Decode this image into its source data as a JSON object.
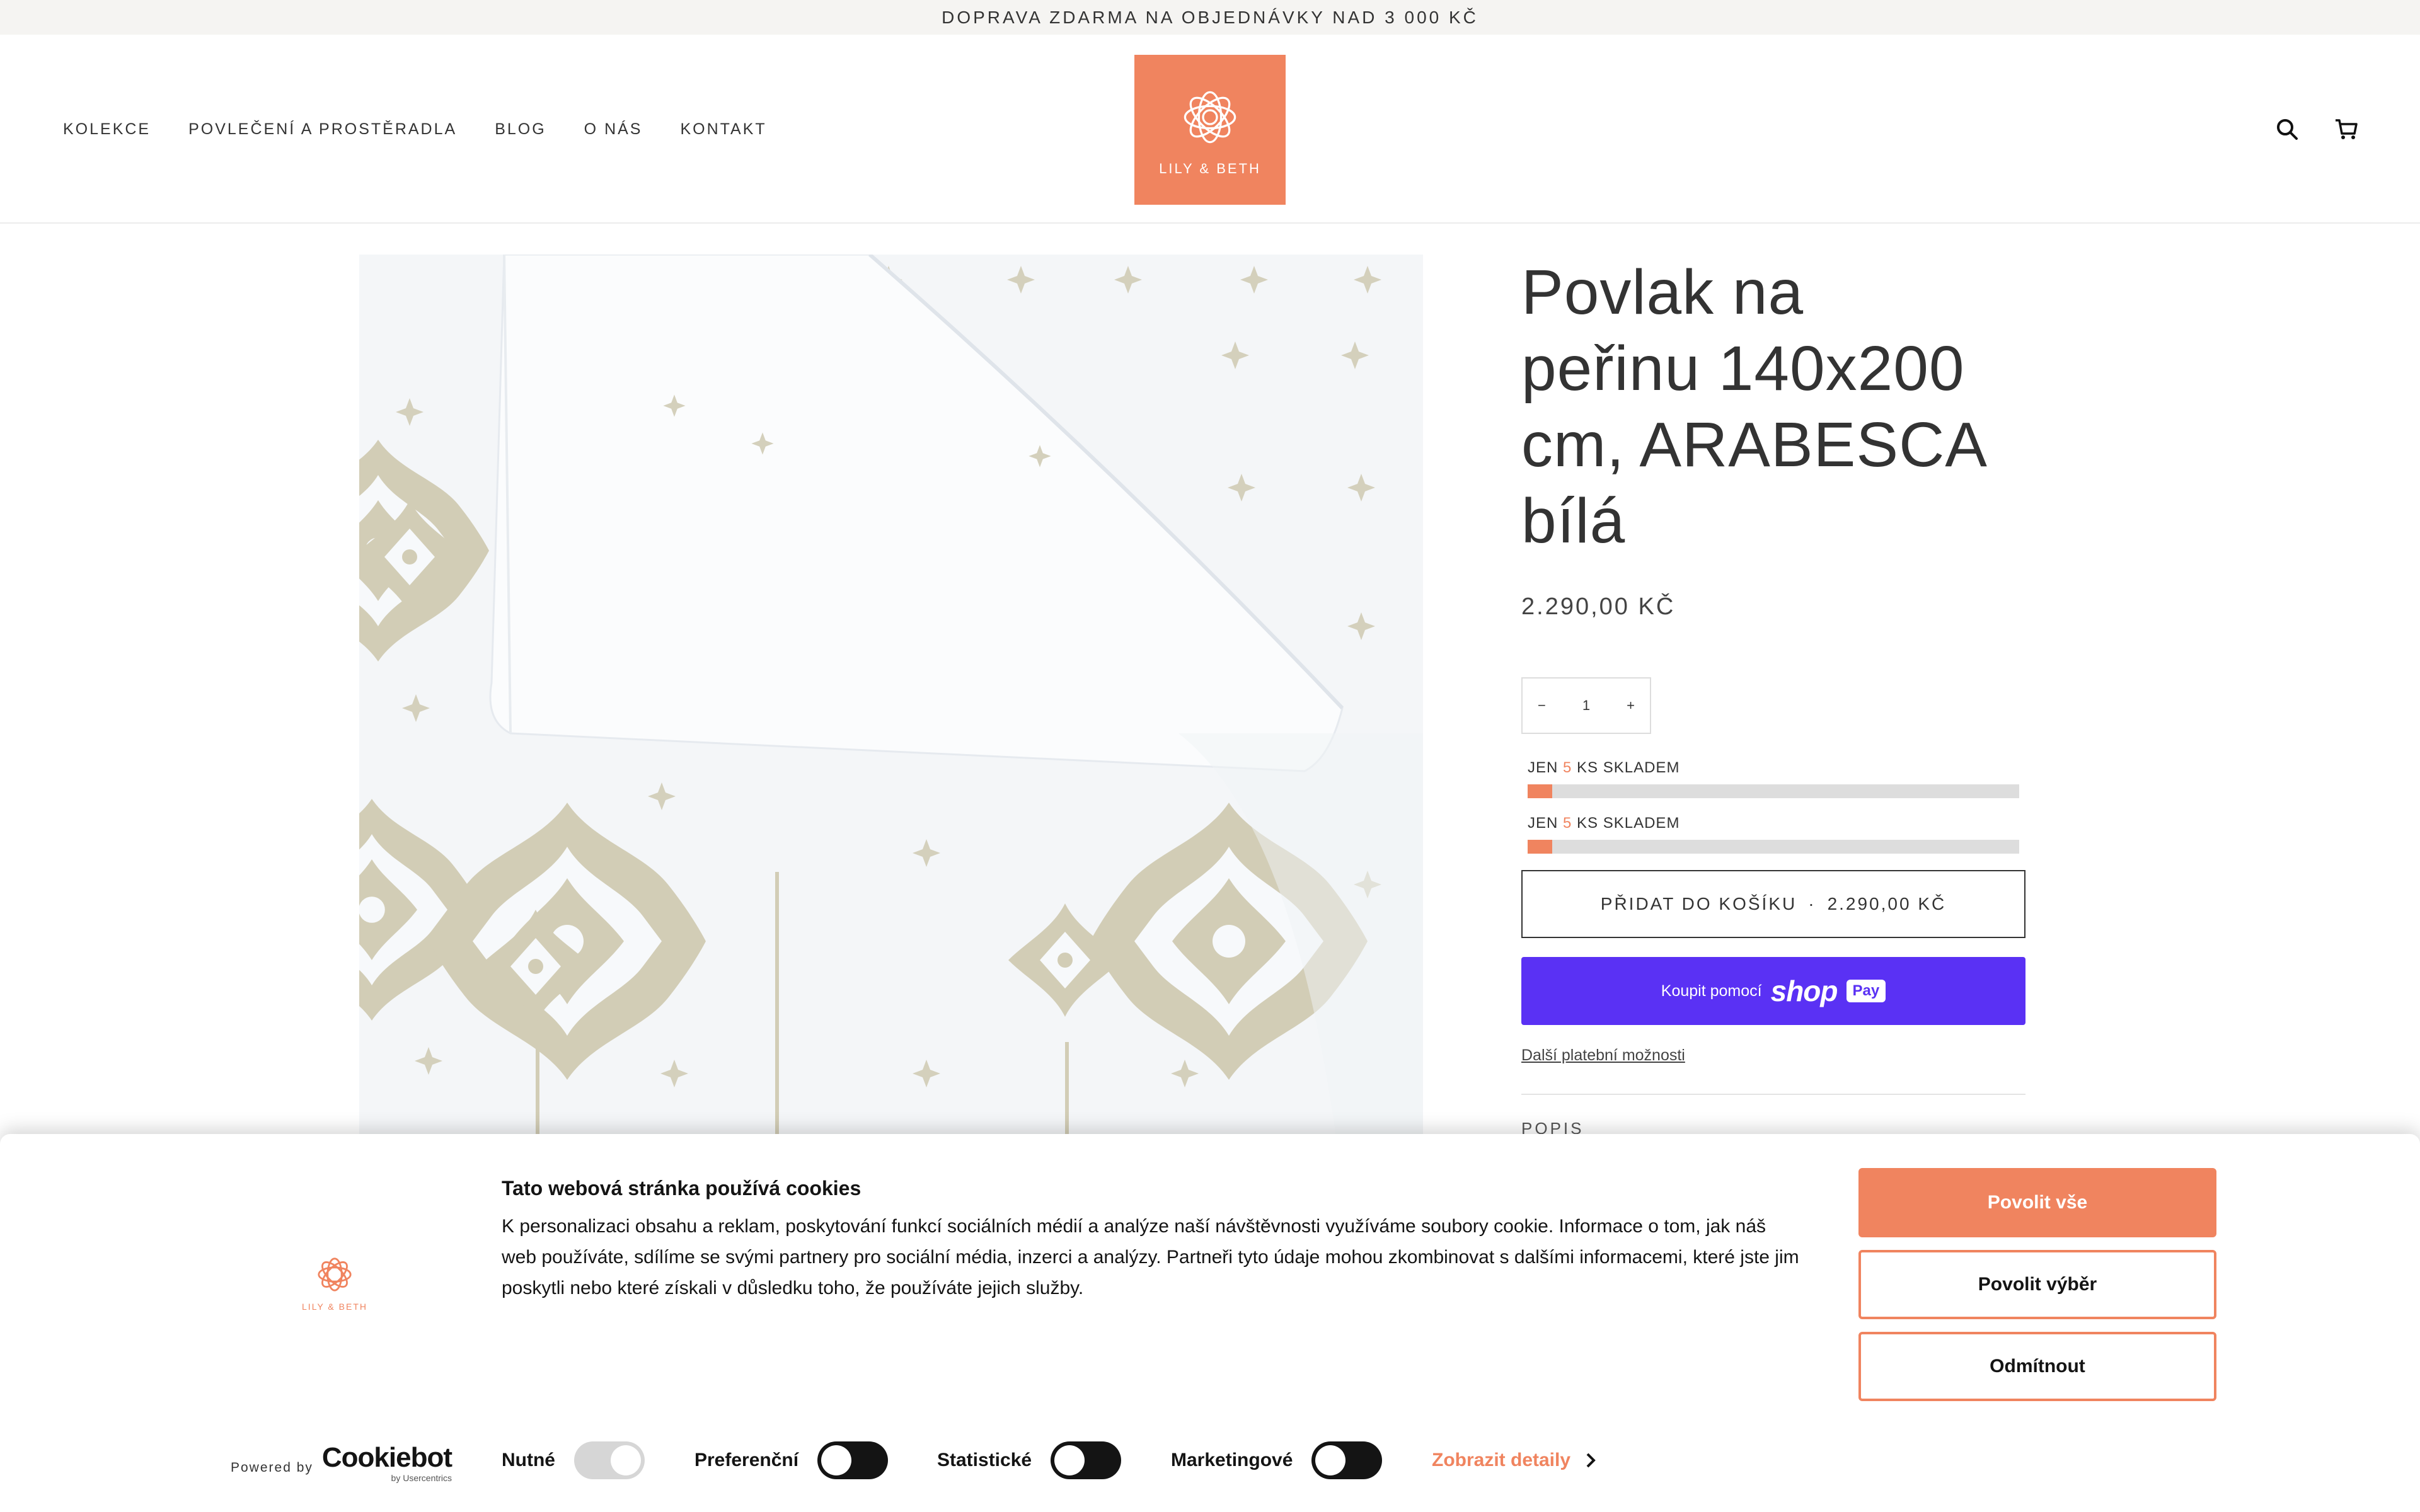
{
  "announcement": "DOPRAVA ZDARMA NA OBJEDNÁVKY NAD 3 000 KČ",
  "nav": {
    "items": [
      "KOLEKCE",
      "POVLEČENÍ A PROSTĚRADLA",
      "BLOG",
      "O NÁS",
      "KONTAKT"
    ]
  },
  "logo": {
    "text": "LILY & BETH"
  },
  "header_icons": [
    "search-icon",
    "cart-icon"
  ],
  "product": {
    "title": "Povlak na peřinu 140x200 cm, ARABESCA bílá",
    "title_lines": [
      "Povlak na",
      "peřinu 140x200",
      "cm, ARABESCA",
      "bílá"
    ],
    "price": "2.290,00 KČ",
    "quantity": {
      "minus": "−",
      "value": "1",
      "plus": "+"
    },
    "stock": [
      {
        "prefix": "JEN",
        "count": "5",
        "suffix": "KS SKLADEM",
        "level_percent": 5
      },
      {
        "prefix": "JEN",
        "count": "5",
        "suffix": "KS SKLADEM",
        "level_percent": 5
      }
    ],
    "add_to_cart": "PŘIDAT DO KOŠÍKU",
    "add_to_cart_sep": "·",
    "add_to_cart_price": "2.290,00 KČ",
    "shop_pay": {
      "prefix": "Koupit pomocí",
      "brand": "shop",
      "badge": "Pay"
    },
    "more_payment": "Další platební možnosti",
    "description_heading": "POPIS"
  },
  "cookie": {
    "logo_text": "LILY & BETH",
    "title": "Tato webová stránka používá cookies",
    "text": "K personalizaci obsahu a reklam, poskytování funkcí sociálních médií a analýze naší návštěvnosti využíváme soubory cookie. Informace o tom, jak náš web používáte, sdílíme se svými partnery pro sociální média, inzerci a analýzy. Partneři tyto údaje mohou zkombinovat s dalšími informacemi, které jste jim poskytli nebo které získali v důsledku toho, že používáte jejich služby.",
    "buttons": {
      "allow_all": "Povolit vše",
      "allow_selection": "Povolit výběr",
      "deny": "Odmítnout"
    },
    "powered_by": "Powered by",
    "cookiebot": "Cookiebot",
    "cookiebot_sub": "by Usercentrics",
    "toggles": [
      {
        "label": "Nutné",
        "state": "on-disabled"
      },
      {
        "label": "Preferenční",
        "state": "off"
      },
      {
        "label": "Statistické",
        "state": "off"
      },
      {
        "label": "Marketingové",
        "state": "off"
      }
    ],
    "details": "Zobrazit detaily"
  },
  "colors": {
    "accent": "#f0845f",
    "shop_pay": "#5a31f4",
    "text": "#333333",
    "pattern": "#cdc9b3"
  }
}
